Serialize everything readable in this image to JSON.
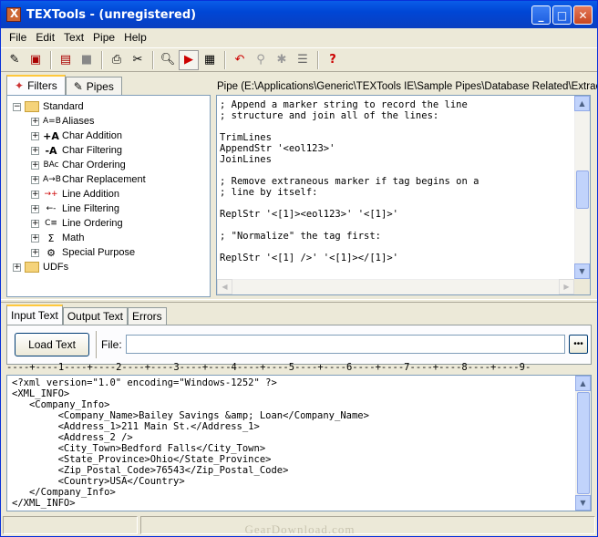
{
  "window": {
    "title": "TEXTools - (unregistered)"
  },
  "menu": [
    "File",
    "Edit",
    "Text",
    "Pipe",
    "Help"
  ],
  "toolbar_icons": [
    "new-pipe-icon",
    "open-pipe-icon",
    "save-icon",
    "disk-icon",
    "print-icon",
    "tools-icon",
    "search-icon",
    "run-icon",
    "screen-icon",
    "undo-icon",
    "step-icon",
    "stop-icon",
    "list-icon",
    "help-icon"
  ],
  "left_tabs": {
    "filters": "Filters",
    "pipes": "Pipes"
  },
  "tree": {
    "standard": "Standard",
    "children": [
      {
        "label": "Aliases",
        "icon": "A=B"
      },
      {
        "label": "Char Addition",
        "icon": "+A"
      },
      {
        "label": "Char Filtering",
        "icon": "-A"
      },
      {
        "label": "Char Ordering",
        "icon": "BAc"
      },
      {
        "label": "Char Replacement",
        "icon": "A→B"
      },
      {
        "label": "Line Addition",
        "icon": "→+"
      },
      {
        "label": "Line Filtering",
        "icon": "←-"
      },
      {
        "label": "Line Ordering",
        "icon": "C≡"
      },
      {
        "label": "Math",
        "icon": "Σ"
      },
      {
        "label": "Special Purpose",
        "icon": "⚙"
      }
    ],
    "udfs": "UDFs"
  },
  "pipe": {
    "path": "Pipe (E:\\Applications\\Generic\\TEXTools IE\\Sample Pipes\\Database Related\\Extract XML",
    "code": "; Append a marker string to record the line\n; structure and join all of the lines:\n\nTrimLines\nAppendStr '<eol123>'\nJoinLines\n\n; Remove extraneous marker if tag begins on a\n; line by itself:\n\nReplStr '<[1]><eol123>' '<[1]>'\n\n; \"Normalize\" the tag first:\n\nReplStr '<[1] />' '<[1]></[1]>'"
  },
  "bottom_tabs": {
    "input": "Input Text",
    "output": "Output Text",
    "errors": "Errors"
  },
  "input_panel": {
    "load_button": "Load Text",
    "file_label": "File:",
    "file_value": "",
    "browse_label": "•••"
  },
  "ruler": "----+----1----+----2----+----3----+----4----+----5----+----6----+----7----+----8----+----9-",
  "input_text": "<?xml version=\"1.0\" encoding=\"Windows-1252\" ?>\n<XML_INFO>\n   <Company_Info>\n        <Company_Name>Bailey Savings &amp; Loan</Company_Name>\n        <Address_1>211 Main St.</Address_1>\n        <Address_2 />\n        <City_Town>Bedford Falls</City_Town>\n        <State_Province>Ohio</State_Province>\n        <Zip_Postal_Code>76543</Zip_Postal_Code>\n        <Country>USA</Country>\n   </Company_Info>\n</XML_INFO>",
  "watermark": "GearDownload.com"
}
